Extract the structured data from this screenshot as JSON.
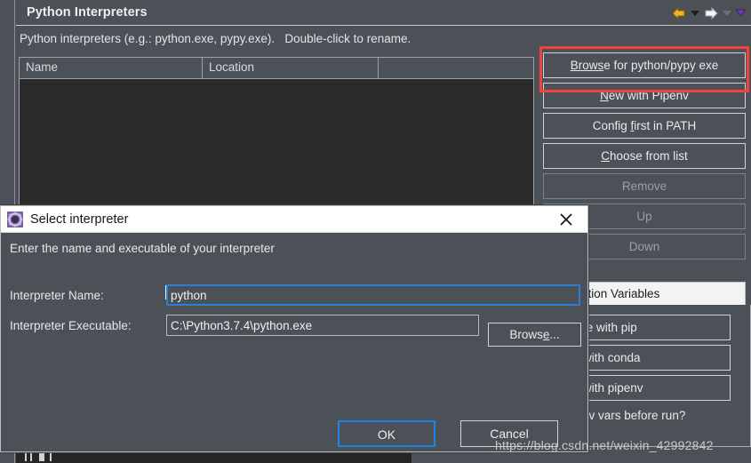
{
  "window": {
    "title": "Python Interpreters",
    "description": "Python interpreters (e.g.: python.exe, pypy.exe).   Double-click to rename.",
    "nav": {
      "back_icon": "back-arrow-icon",
      "back_menu_icon": "chevron-down-icon",
      "forward_icon": "forward-arrow-icon",
      "forward_menu_icon": "chevron-down-icon",
      "overflow_menu_icon": "chevron-down-icon"
    }
  },
  "table": {
    "columns": [
      "Name",
      "Location",
      ""
    ],
    "rows": []
  },
  "side_buttons": [
    {
      "label": "Browse for python/pypy exe",
      "mnemonic": "e",
      "enabled": true,
      "highlighted": true
    },
    {
      "label": "New with Pipenv",
      "mnemonic": "N",
      "enabled": true,
      "highlighted": false
    },
    {
      "label": "Config first in PATH",
      "mnemonic": "f",
      "enabled": true,
      "highlighted": false
    },
    {
      "label": "Choose from list",
      "mnemonic": "C",
      "enabled": true,
      "highlighted": false
    },
    {
      "label": "Remove",
      "enabled": false,
      "highlighted": false
    },
    {
      "label": "Up",
      "enabled": false,
      "highlighted": false
    },
    {
      "label": "Down",
      "enabled": false,
      "highlighted": false
    }
  ],
  "tabs": {
    "selected": "...ostitution Variables",
    "selected_full": "String Substitution Variables"
  },
  "lower_buttons": [
    {
      "label": "...nage with pip",
      "enabled": true
    },
    {
      "label": "...ge with conda",
      "enabled": true
    },
    {
      "label": "...ge with pipenv",
      "enabled": true
    }
  ],
  "lower_checkbox": {
    "label": "...a env vars before run?"
  },
  "dialog": {
    "title": "Select interpreter",
    "icon": "pydev-gear-icon",
    "close_icon": "close-icon",
    "subtitle": "Enter the name and executable of your interpreter",
    "fields": [
      {
        "label": "Interpreter Name:",
        "value": "python",
        "placeholder": "",
        "focused": true
      },
      {
        "label": "Interpreter Executable:",
        "value": "C:\\Python3.7.4\\python.exe",
        "placeholder": "",
        "focused": false
      }
    ],
    "browse_button": {
      "label": "Browse...",
      "mnemonic": "e"
    },
    "ok_button": "OK",
    "cancel_button": "Cancel"
  },
  "watermark": "https://blog.csdn.net/weixin_42992842",
  "colors": {
    "bg": "#4b5157",
    "list_bg": "#2b2b2b",
    "text": "#e8ebee",
    "accent_focus": "#1e83e4",
    "highlight_rect": "#f4413c",
    "titlebar_white": "#ffffff"
  }
}
